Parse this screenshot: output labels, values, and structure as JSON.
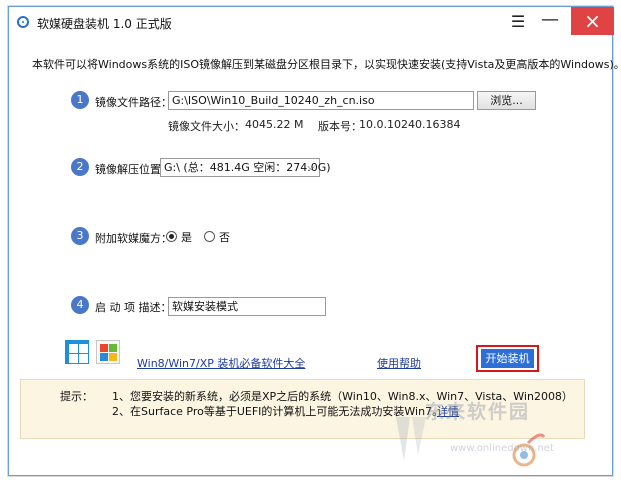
{
  "window": {
    "title": "软媒硬盘装机 1.0 正式版",
    "menu_icon": "hamburger-icon",
    "minimize_icon": "minimize-icon",
    "close_icon": "close-icon"
  },
  "intro": "本软件可以将Windows系统的ISO镜像解压到某磁盘分区根目录下，以实现快速安装(支持Vista及更高版本的Windows)。",
  "steps": [
    {
      "num": "1",
      "label": "镜像文件路径："
    },
    {
      "num": "2",
      "label": "镜像解压位置："
    },
    {
      "num": "3",
      "label": "附加软媒魔方："
    },
    {
      "num": "4",
      "label": "启 动 项 描述："
    }
  ],
  "image_path": {
    "value": "G:\\ISO\\Win10_Build_10240_zh_cn.iso",
    "browse_label": "浏览..."
  },
  "image_info": {
    "size_label": "镜像文件大小：",
    "size_value": "4045.22 M",
    "version_label": "版本号：",
    "version_value": "10.0.10240.16384"
  },
  "extract_location": {
    "selected": "G:\\ (总：481.4G 空闲：274.0G)"
  },
  "magic_cube": {
    "options": [
      {
        "label": "是",
        "checked": true
      },
      {
        "label": "否",
        "checked": false
      }
    ]
  },
  "boot_description": {
    "value": "软媒安装模式"
  },
  "footer": {
    "win8_icon": "windows8-logo-icon",
    "win7_icon": "windows7-logo-icon",
    "software_link": "Win8/Win7/XP 装机必备软件大全",
    "help_link": "使用帮助",
    "start_button": "开始装机"
  },
  "tips": {
    "label": "提示：",
    "line1": "1、您要安装的新系统，必须是XP之后的系统（Win10、Win8.x、Win7、Vista、Win2008）",
    "line2": "2、在Surface Pro等基于UEFI的计算机上可能无法成功安装Win7。",
    "detail_link": "详情"
  },
  "watermark": {
    "text": "东来软件园",
    "url": "www.onlinedown.net"
  },
  "colors": {
    "accent": "#4a78c9",
    "close": "#e04343",
    "start": "#2d6fd6",
    "tips_bg": "#fbf5e2"
  }
}
